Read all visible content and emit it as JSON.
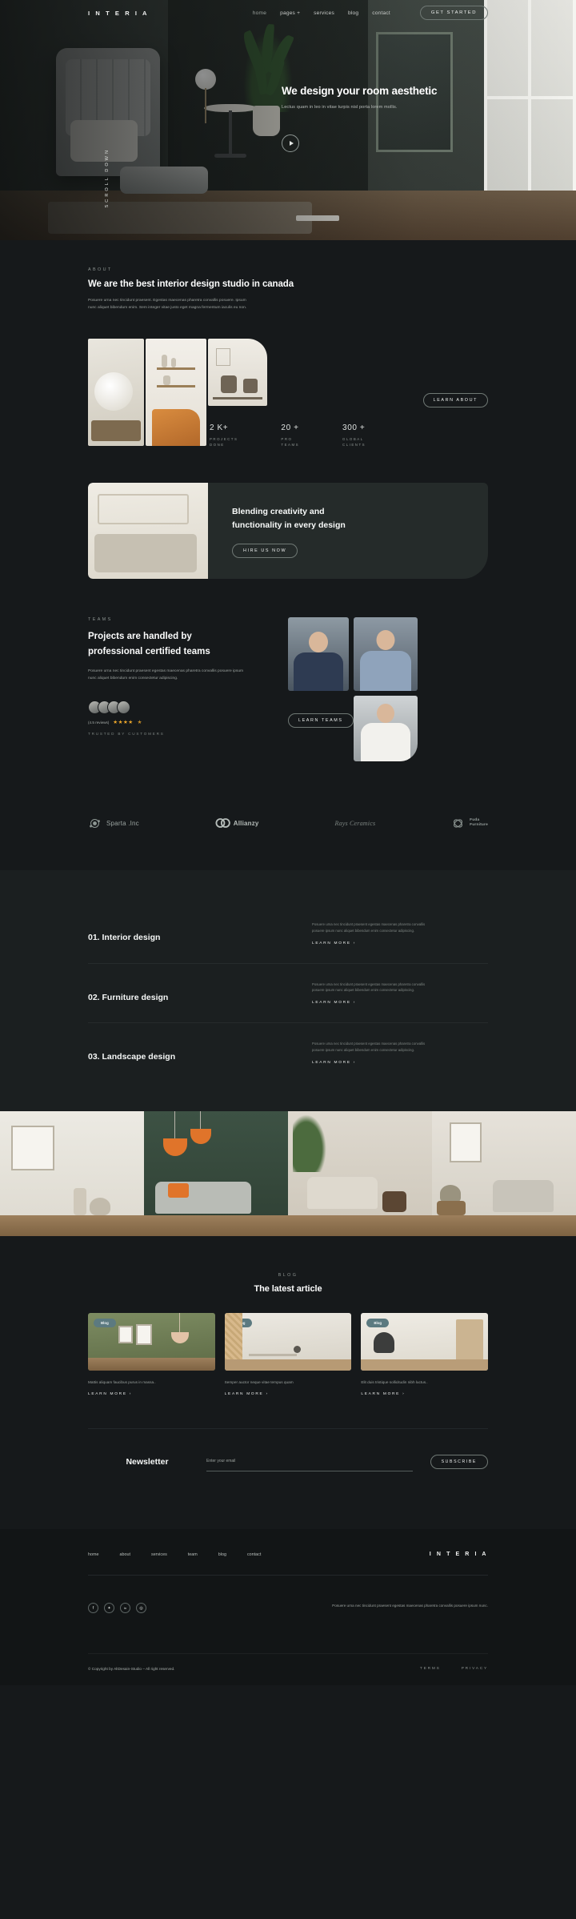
{
  "brand": "I N T E R I A",
  "nav": {
    "items": [
      {
        "label": "home",
        "active": true
      },
      {
        "label": "pages +",
        "active": false
      },
      {
        "label": "services",
        "active": false
      },
      {
        "label": "blog",
        "active": false
      },
      {
        "label": "contact",
        "active": false
      }
    ],
    "cta": "GET STARTED"
  },
  "hero": {
    "title": "We design your room aesthetic",
    "subtitle": "Lectus quam in leo in vitae turpis nisl porta lorem mollis.",
    "scroll_label": "SCROLL DOWN",
    "play_icon": "play-icon"
  },
  "about": {
    "eyebrow": "ABOUT",
    "title": "We are the best interior design studio in canada",
    "paragraph": "Posuere urna nec tincidunt praesent. Egestas maecenas pharetra convallis posuere. Ipsum nunc aliquet bibendum enim. Sem integer vitae justo eget magna fermentum iaculis eu non.",
    "button": "LEARN ABOUT",
    "stats": [
      {
        "value": "2 K+",
        "label": "PROJECTS\nDONE"
      },
      {
        "value": "20 +",
        "label": "PRO\nTEAMS"
      },
      {
        "value": "300 +",
        "label": "GLOBAL\nCLIENTS"
      }
    ]
  },
  "cta_banner": {
    "title_line1": "Blending creativity and",
    "title_line2": "functionality in every design",
    "button": "HIRE US NOW"
  },
  "teams": {
    "eyebrow": "TEAMS",
    "title": "Projects are handled by professional certified teams",
    "paragraph": "Posuere urna nec tincidunt praesent egestas maecenas pharetra convallis posuere ipsum nunc aliquet bibendum enim consectetur adipiscing.",
    "reviews_text": "(4.5 reviews)",
    "stars": "★★★★",
    "half_star": "★",
    "trusted": "TRUSTED BY CUSTOMERS",
    "button": "LEARN TEAMS"
  },
  "logos": [
    {
      "name": "Sparta .Inc",
      "icon": "sparta-logo-icon",
      "style": "normal"
    },
    {
      "name": "Allianzy",
      "icon": "allianzy-logo-icon",
      "style": "bold"
    },
    {
      "name": "Rays Ceramics",
      "icon": "rays-ceramics-logo-icon",
      "style": "script"
    },
    {
      "name": "Fuda\nFurniture",
      "icon": "fuda-furniture-logo-icon",
      "style": "small"
    }
  ],
  "services": [
    {
      "title": "01. Interior design",
      "desc": "Posuere urna nec tincidunt praesent egestas maecenas pharetra convallis posuere ipsum nunc aliquet bibendum enim consectetur adipiscing.",
      "learn": "LEARN MORE"
    },
    {
      "title": "02. Furniture design",
      "desc": "Posuere urna nec tincidunt praesent egestas maecenas pharetra convallis posuere ipsum nunc aliquet bibendum enim consectetur adipiscing.",
      "learn": "LEARN MORE"
    },
    {
      "title": "03. Landscape design",
      "desc": "Posuere urna nec tincidunt praesent egestas maecenas pharetra convallis posuere ipsum nunc aliquet bibendum enim consectetur adipiscing.",
      "learn": "LEARN MORE"
    }
  ],
  "blog": {
    "eyebrow": "BLOG",
    "title": "The latest article",
    "posts": [
      {
        "badge": "Blog",
        "title": "Mattis aliquam faucibus purus in massa.."
      },
      {
        "badge": "Blog",
        "title": "Semper auctor neque vitae tempus quam"
      },
      {
        "badge": "Blog",
        "title": "Elit duis tristique sollicitudin nibh luctus.."
      }
    ],
    "learn": "LEARN MORE"
  },
  "newsletter": {
    "title": "Newsletter",
    "placeholder": "Enter your email",
    "value": "",
    "button": "SUBSCRIBE"
  },
  "footer": {
    "links": [
      "home",
      "about",
      "services",
      "team",
      "blog",
      "contact"
    ],
    "brand": "I N T E R I A",
    "socials": [
      {
        "icon": "facebook-icon",
        "glyph": "f"
      },
      {
        "icon": "twitter-icon",
        "glyph": "✦"
      },
      {
        "icon": "linkedin-icon",
        "glyph": "in"
      },
      {
        "icon": "instagram-icon",
        "glyph": "◎"
      }
    ],
    "description": "Posuere urna nec tincidunt praesent egestas maecenas pharetra convallis posuere ipsum nunc.",
    "copyright": "© Copyright by AltDesain-Studio – All right reserved.",
    "terms": "TERMS",
    "privacy": "PRIVACY"
  },
  "colors": {
    "background": "#16191b",
    "panel": "#1b1f20",
    "footer": "#121516",
    "text": "#f5f7f6",
    "muted": "#9aa09d",
    "star": "#f0a92a",
    "badge": "#5c7a80",
    "accent_orange": "#e0742a"
  }
}
